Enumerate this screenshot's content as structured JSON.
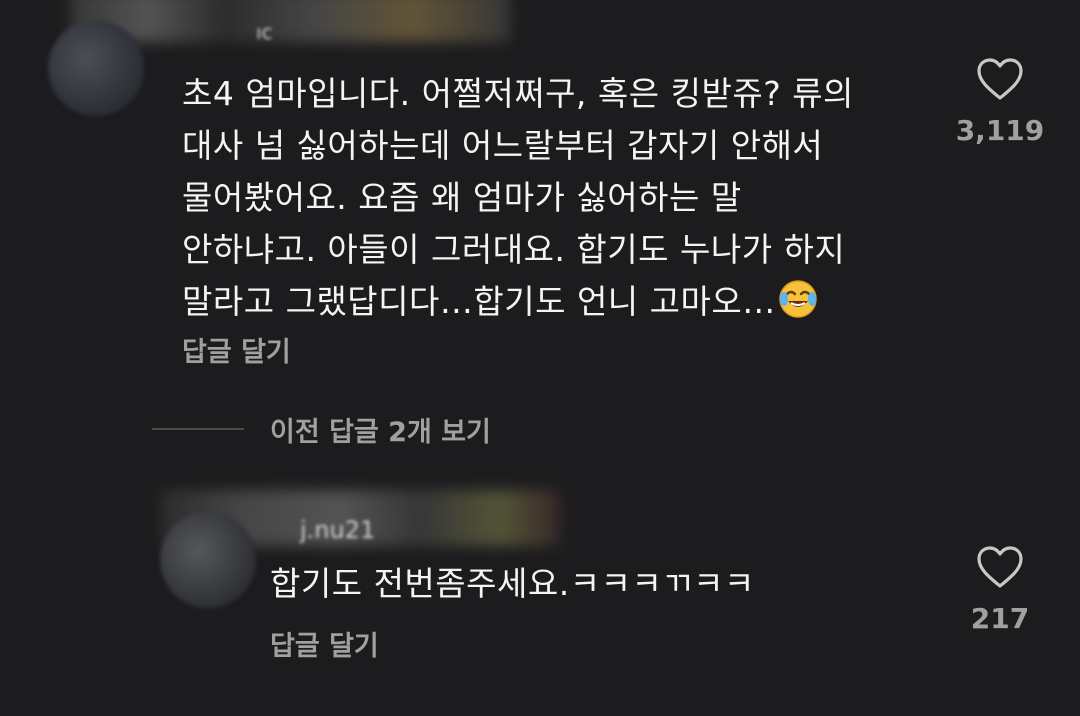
{
  "comments": [
    {
      "username_fragment": "ıc",
      "body_lines": [
        "초4 엄마입니다. 어쩔저쩌구, 혹은 킹받쥬? 류의",
        "대사 넘 싫어하는데 어느랄부터 갑자기 안해서",
        "물어봤어요. 요즘 왜 엄마가 싫어하는 말",
        "안하냐고. 아들이 그러대요. 합기도 누나가 하지",
        "말라고 그랬답디다…합기도 언니 고마오…"
      ],
      "emoji": "face-with-tears-of-joy-icon",
      "reply_label": "답글 달기",
      "like_count": "3,119"
    },
    {
      "username_fragment": "j.nu21",
      "body_lines": [
        "합기도 전번좀주세요.ㅋㅋㅋㄲㅋㅋ"
      ],
      "reply_label": "답글 달기",
      "like_count": "217"
    }
  ],
  "view_previous_replies": "이전 답글 2개 보기",
  "colors": {
    "background": "#1c1c1e",
    "text": "#f4f4f4",
    "secondary_text": "#a0a0a0",
    "heart_outline": "#c8c8c8"
  }
}
